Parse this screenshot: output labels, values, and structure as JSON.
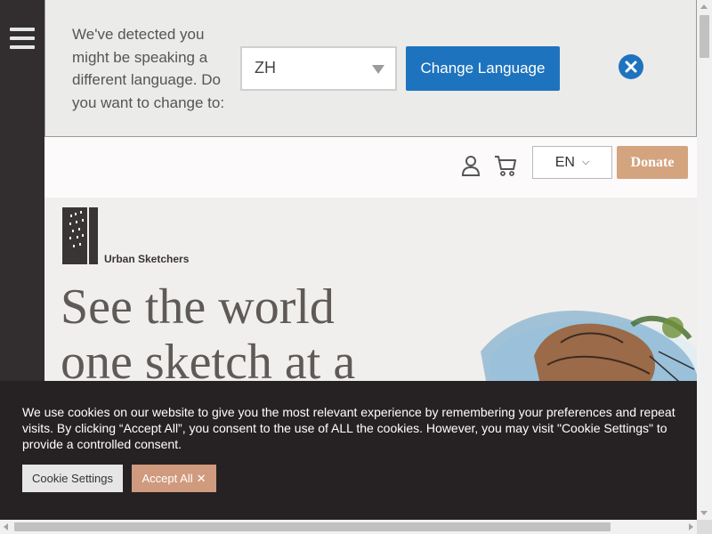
{
  "language_banner": {
    "message": "We've detected you might be speaking a different language. Do you want to change to:",
    "selected_language": "ZH",
    "change_button_label": "Change Language"
  },
  "header": {
    "language": "EN",
    "donate_label": "Donate"
  },
  "hero": {
    "logo_text": "Urban Sketchers",
    "title": "See the world one sketch at a time"
  },
  "cookie_banner": {
    "text": "We use cookies on our website to give you the most relevant experience by remembering your preferences and repeat visits. By clicking “Accept All”, you consent to the use of ALL the cookies. However, you may visit \"Cookie Settings\" to provide a controlled consent.",
    "settings_label": "Cookie Settings",
    "accept_label": "Accept All"
  },
  "icons": {
    "menu": "hamburger-icon",
    "close": "close-icon",
    "user": "user-icon",
    "cart": "cart-icon",
    "chevron": "chevron-down-icon",
    "logo": "urban-sketchers-logo"
  },
  "colors": {
    "sidebar": "#322d2e",
    "primary_button": "#1e73be",
    "donate": "#d4a47f",
    "accept": "#d09a7e",
    "cookie_bg": "#262223",
    "hero_bg": "#f1efed"
  }
}
